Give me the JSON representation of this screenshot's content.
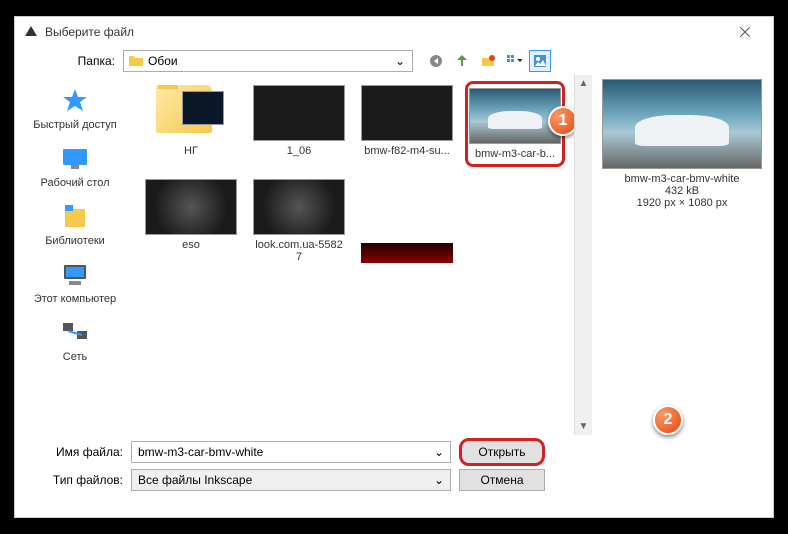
{
  "title": "Выберите файл",
  "folder_label": "Папка:",
  "current_folder": "Обои",
  "sidebar": {
    "items": [
      {
        "label": "Быстрый доступ"
      },
      {
        "label": "Рабочий стол"
      },
      {
        "label": "Библиотеки"
      },
      {
        "label": "Этот компьютер"
      },
      {
        "label": "Сеть"
      }
    ]
  },
  "files": [
    {
      "label": "НГ",
      "type": "folder"
    },
    {
      "label": "1_06",
      "type": "image"
    },
    {
      "label": "bmw-f82-m4-su...",
      "type": "image"
    },
    {
      "label": "bmw-m3-car-b...",
      "type": "image",
      "selected": true
    },
    {
      "label": "eso",
      "type": "image"
    },
    {
      "label": "look.com.ua-55827",
      "type": "image"
    }
  ],
  "preview": {
    "name": "bmw-m3-car-bmv-white",
    "size": "432 kB",
    "dimensions": "1920 px × 1080 px"
  },
  "filename_label": "Имя файла:",
  "filename_value": "bmw-m3-car-bmv-white",
  "filetype_label": "Тип файлов:",
  "filetype_value": "Все файлы Inkscape",
  "open_btn": "Открыть",
  "cancel_btn": "Отмена",
  "callouts": {
    "one": "1",
    "two": "2"
  }
}
